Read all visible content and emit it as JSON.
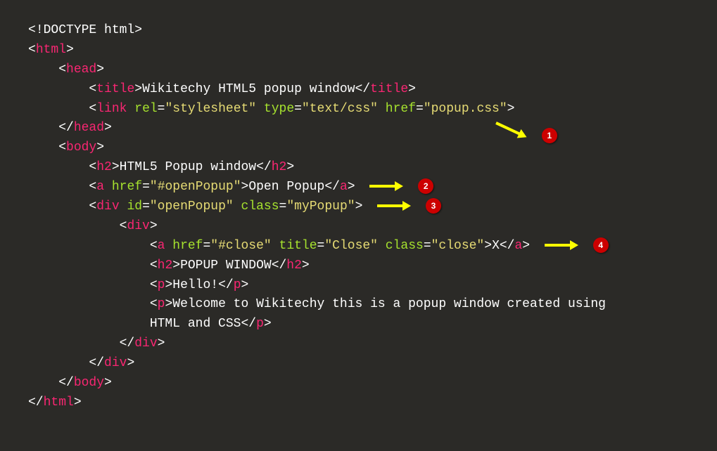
{
  "code": {
    "doctype": "<!DOCTYPE html>",
    "html_open": "html",
    "head_open": "head",
    "title_tag": "title",
    "title_text": "Wikitechy HTML5 popup window",
    "link_tag": "link",
    "link_rel_attr": "rel",
    "link_rel_val": "\"stylesheet\"",
    "link_type_attr": "type",
    "link_type_val": "\"text/css\"",
    "link_href_attr": "href",
    "link_href_val": "\"popup.css\"",
    "head_close": "head",
    "body_open": "body",
    "h2_tag": "h2",
    "h2_text": "HTML5 Popup window",
    "a_tag": "a",
    "a_href_attr": "href",
    "a_href_val": "\"#openPopup\"",
    "a_text": "Open Popup",
    "div_tag": "div",
    "div_id_attr": "id",
    "div_id_val": "\"openPopup\"",
    "div_class_attr": "class",
    "div_class_val": "\"myPopup\"",
    "a2_href_val": "\"#close\"",
    "a2_title_attr": "title",
    "a2_title_val": "\"Close\"",
    "a2_class_attr": "class",
    "a2_class_val": "\"close\"",
    "a2_text": "X",
    "h2b_text": "POPUP WINDOW",
    "p_tag": "p",
    "p1_text": "Hello!",
    "p2_text": "Welcome to Wikitechy this is a popup window created using",
    "p2_text2": "HTML and CSS",
    "body_close": "body",
    "html_close": "html"
  },
  "annotations": {
    "b1": "1",
    "b2": "2",
    "b3": "3",
    "b4": "4"
  }
}
